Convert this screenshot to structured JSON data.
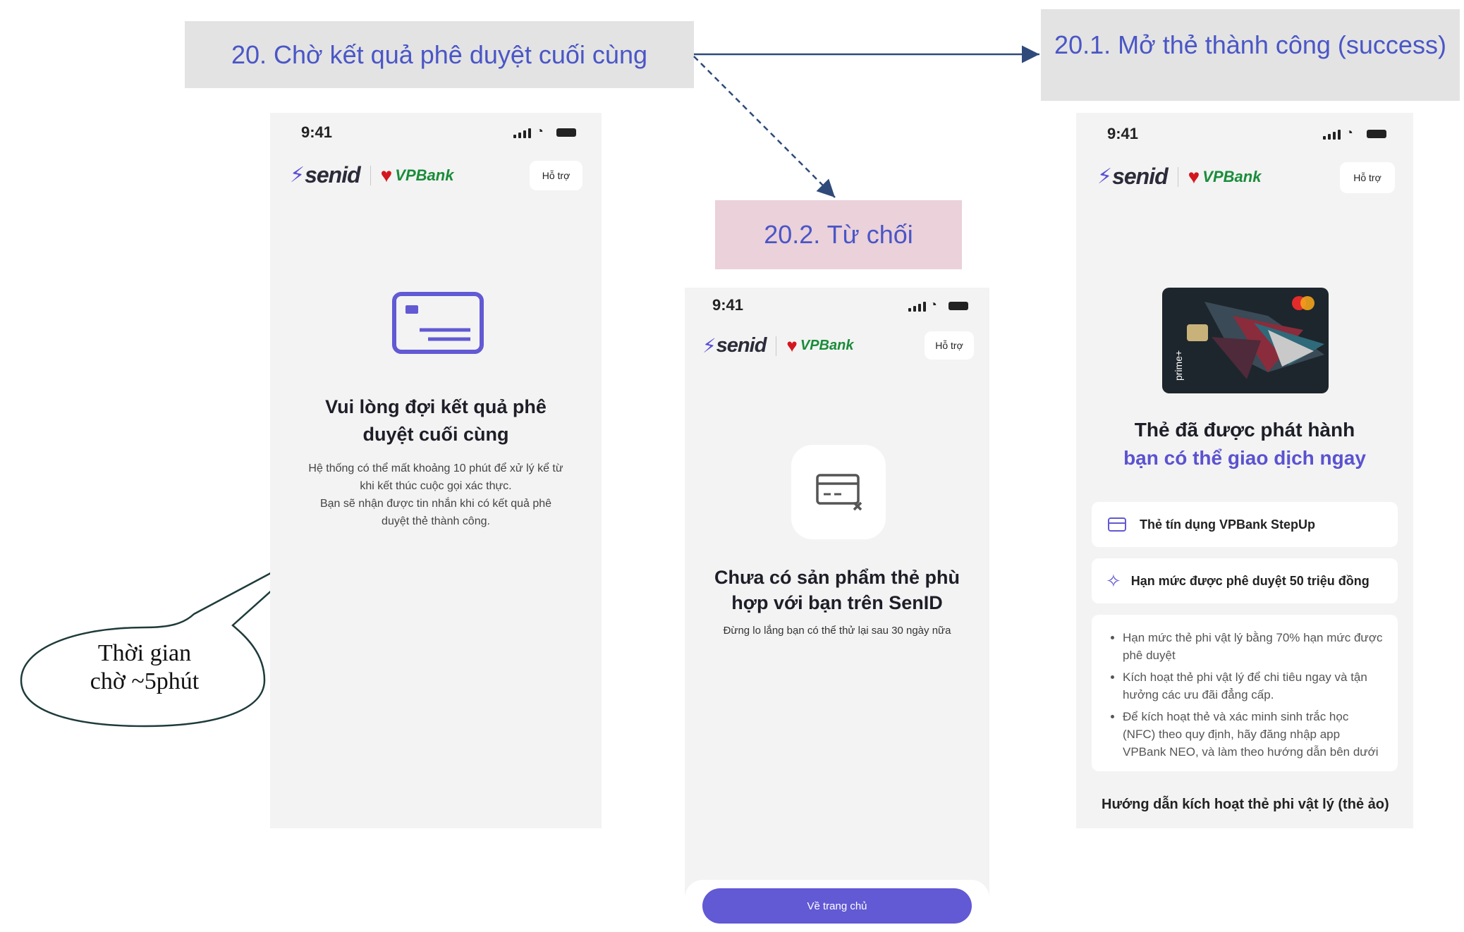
{
  "labels": {
    "main": "20. Chờ kết quả phê duyệt cuối cùng",
    "success": "20.1. Mở thẻ thành công (success)",
    "reject": "20.2. Từ chối"
  },
  "colors": {
    "label_main_bg": "#e3e3e3",
    "label_reject_bg": "#ead1da",
    "label_text": "#4a56c6",
    "accent": "#6259d4",
    "brand_green": "#1a8c3a",
    "brand_red": "#d4161e"
  },
  "common": {
    "time": "9:41",
    "support": "Hỗ trợ",
    "senid": "senid",
    "vpbank": "VPBank"
  },
  "screen_wait": {
    "icon": "credit-card-icon",
    "title_line1": "Vui lòng đợi kết quả phê",
    "title_line2": "duyệt cuối cùng",
    "desc_line1": "Hệ thống có thể mất khoảng 10 phút để xử lý kể từ",
    "desc_line2": "khi kết thúc cuộc gọi xác thực.",
    "desc_line3": "Bạn sẽ nhận được tin nhắn khi có kết quả phê",
    "desc_line4": "duyệt thẻ thành công."
  },
  "callout": {
    "line1": "Thời gian",
    "line2": "chờ ~5phút"
  },
  "screen_reject": {
    "icon": "card-reject-icon",
    "title_line1": "Chưa có sản phẩm thẻ phù",
    "title_line2": "hợp với bạn trên SenID",
    "desc": "Đừng lo lắng bạn có thể thử lại sau 30 ngày nữa",
    "button": "Về trang chủ"
  },
  "screen_success": {
    "card_image": "vpbank-prime-card",
    "title_line1": "Thẻ đã được phát hành",
    "title_line2": "bạn có thể giao dịch ngay",
    "row1": "Thẻ tín dụng VPBank StepUp",
    "row2": "Hạn mức được phê duyệt 50 triệu đồng",
    "notes": [
      "Hạn mức thẻ phi vật lý bằng 70% hạn mức được phê duyệt",
      "Kích hoạt thẻ phi vật lý để chi tiêu ngay và tận hưởng các ưu đãi đẳng cấp.",
      "Để kích hoạt thẻ và xác minh sinh trắc học (NFC) theo quy định, hãy đăng nhập app VPBank NEO, và làm theo hướng dẫn bên dưới"
    ],
    "guide": "Hướng dẫn kích hoạt thẻ phi vật lý (thẻ ảo)"
  }
}
